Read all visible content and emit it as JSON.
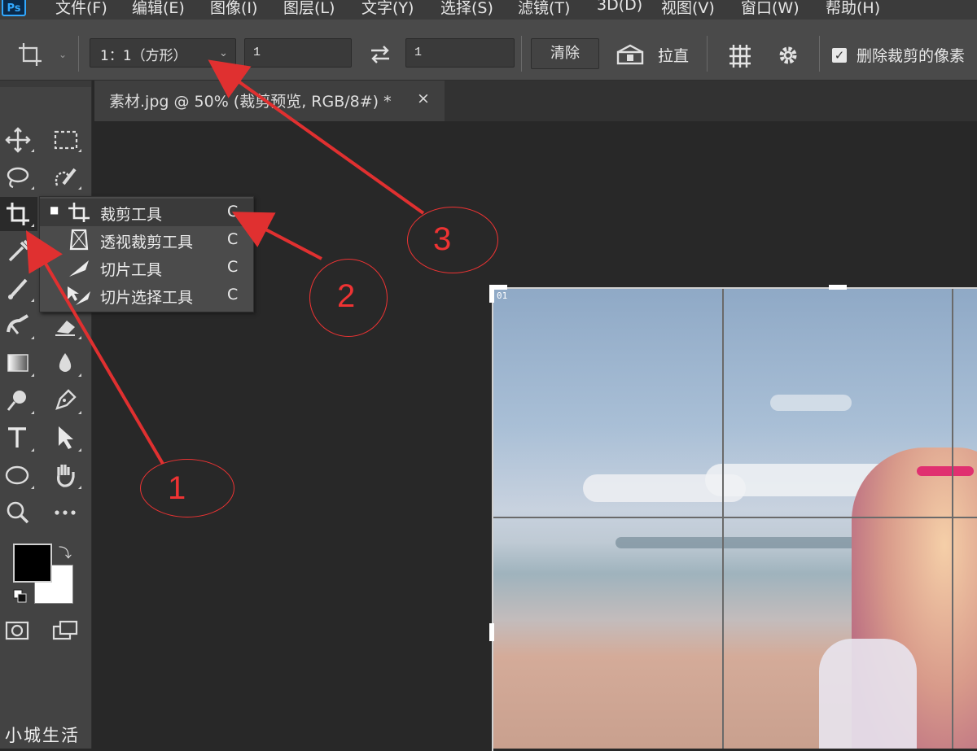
{
  "app": {
    "logo": "Ps"
  },
  "menubar": {
    "items": [
      "文件(F)",
      "编辑(E)",
      "图像(I)",
      "图层(L)",
      "文字(Y)",
      "选择(S)",
      "滤镜(T)",
      "3D(D)",
      "视图(V)",
      "窗口(W)",
      "帮助(H)"
    ]
  },
  "options": {
    "crop_tool_icon": "crop-icon",
    "ratio_select": "1：1（方形）",
    "width_value": "1",
    "height_value": "1",
    "swap_icon": "swap-arrows-icon",
    "clear_label": "清除",
    "straighten_label": "拉直",
    "overlay_icon": "grid-overlay-icon",
    "settings_icon": "gear-icon",
    "delete_cropped_pixels_label": "删除裁剪的像素",
    "delete_cropped_pixels_checked": true
  },
  "document_tab": {
    "title": "素材.jpg @ 50% (裁剪预览, RGB/8#) *",
    "close": "×"
  },
  "crop_overlay_label": "01",
  "flyout": {
    "items": [
      {
        "label": "裁剪工具",
        "shortcut": "C",
        "selected": true,
        "icon": "crop-icon"
      },
      {
        "label": "透视裁剪工具",
        "shortcut": "C",
        "selected": false,
        "icon": "perspective-crop-icon"
      },
      {
        "label": "切片工具",
        "shortcut": "C",
        "selected": false,
        "icon": "slice-icon"
      },
      {
        "label": "切片选择工具",
        "shortcut": "C",
        "selected": false,
        "icon": "slice-select-icon"
      }
    ]
  },
  "annotations": {
    "labels": [
      "1",
      "2",
      "3"
    ],
    "color": "#e03030"
  },
  "colors": {
    "foreground": "#000000",
    "background": "#ffffff"
  },
  "watermark": "小城生活"
}
